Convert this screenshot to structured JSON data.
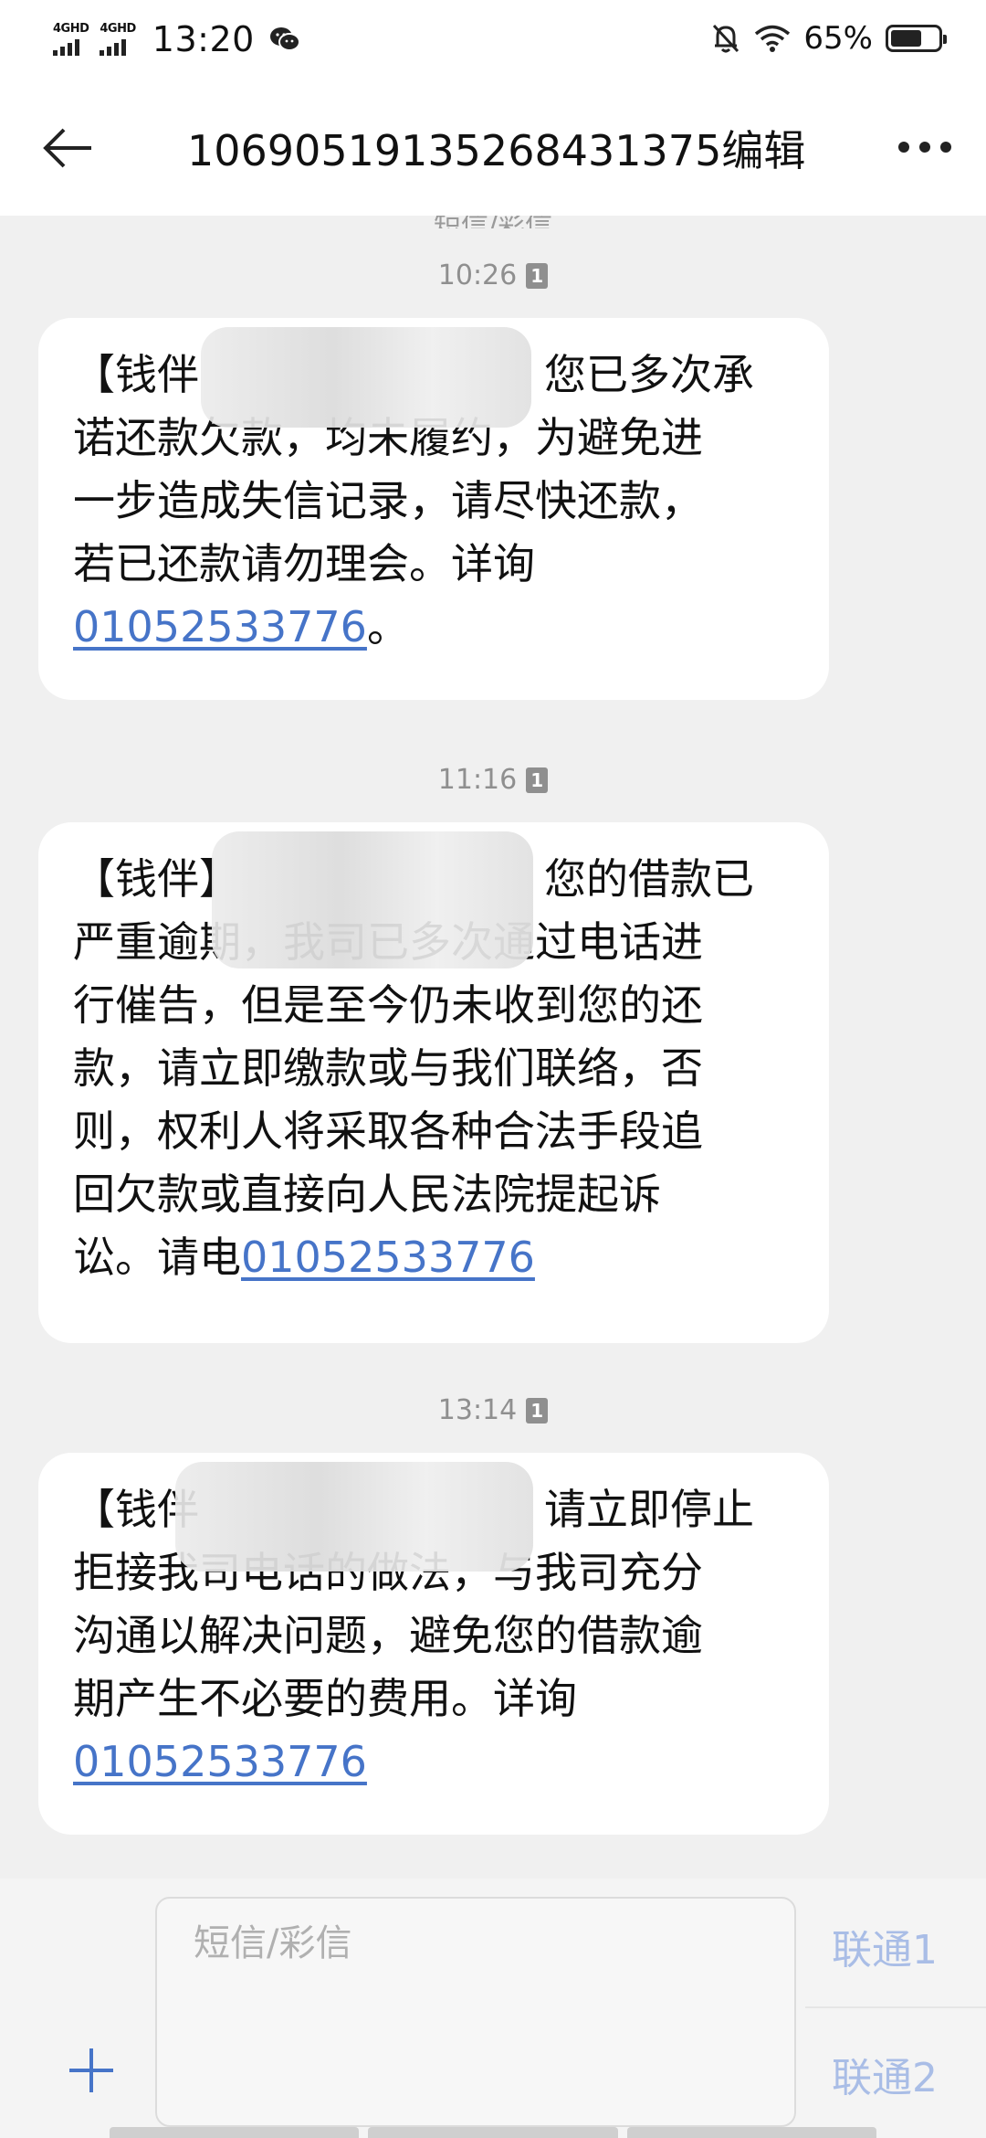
{
  "status": {
    "signal1": "4GHD",
    "signal2": "4GHD",
    "time": "13:20",
    "battery": "65%",
    "battery_level": 0.65,
    "icons": [
      "wechat-icon",
      "mute-bell-icon",
      "wifi-icon",
      "battery-icon"
    ]
  },
  "header": {
    "title": "1069051913526843​1375编辑",
    "back_icon": "back-arrow-icon",
    "more_icon": "more-icon"
  },
  "thread": {
    "cut_label": "短信/彩信",
    "messages": [
      {
        "time": "10:26",
        "sim": "1",
        "lines": [
          "【钱伴",
          "您已多次承",
          "诺还款欠款，均未履约，为避免进",
          "一步造成失信记录，请尽快还款，",
          "若已还款请勿理会。详询"
        ],
        "phone": "01052533776",
        "tail": "。"
      },
      {
        "time": "11:16",
        "sim": "1",
        "lines": [
          "【钱伴】",
          "您的借款已",
          "严重逾期，我司已多次通过电话进",
          "行催告，但是至今仍未收到您的还",
          "款，请立即缴款或与我们联络，否",
          "则，权利人将采取各种合法手段追",
          "回欠款或直接向人民法院提起诉",
          "讼。请电"
        ],
        "phone": "01052533776",
        "tail": ""
      },
      {
        "time": "13:14",
        "sim": "1",
        "lines": [
          "【钱伴",
          "请立即停止",
          "拒接我司电话的做法，与我司充分",
          "沟通以解决问题，避免您的借款逾",
          "期产生不必要的费用。详询"
        ],
        "phone": "01052533776",
        "tail": ""
      }
    ]
  },
  "composer": {
    "placeholder": "短信/彩信",
    "sim1_label": "联通1",
    "sim2_label": "联通2",
    "add_icon": "plus-icon"
  },
  "colors": {
    "link": "#4674c8",
    "sim_button": "#a9bde6",
    "background": "#f0f0f0"
  }
}
